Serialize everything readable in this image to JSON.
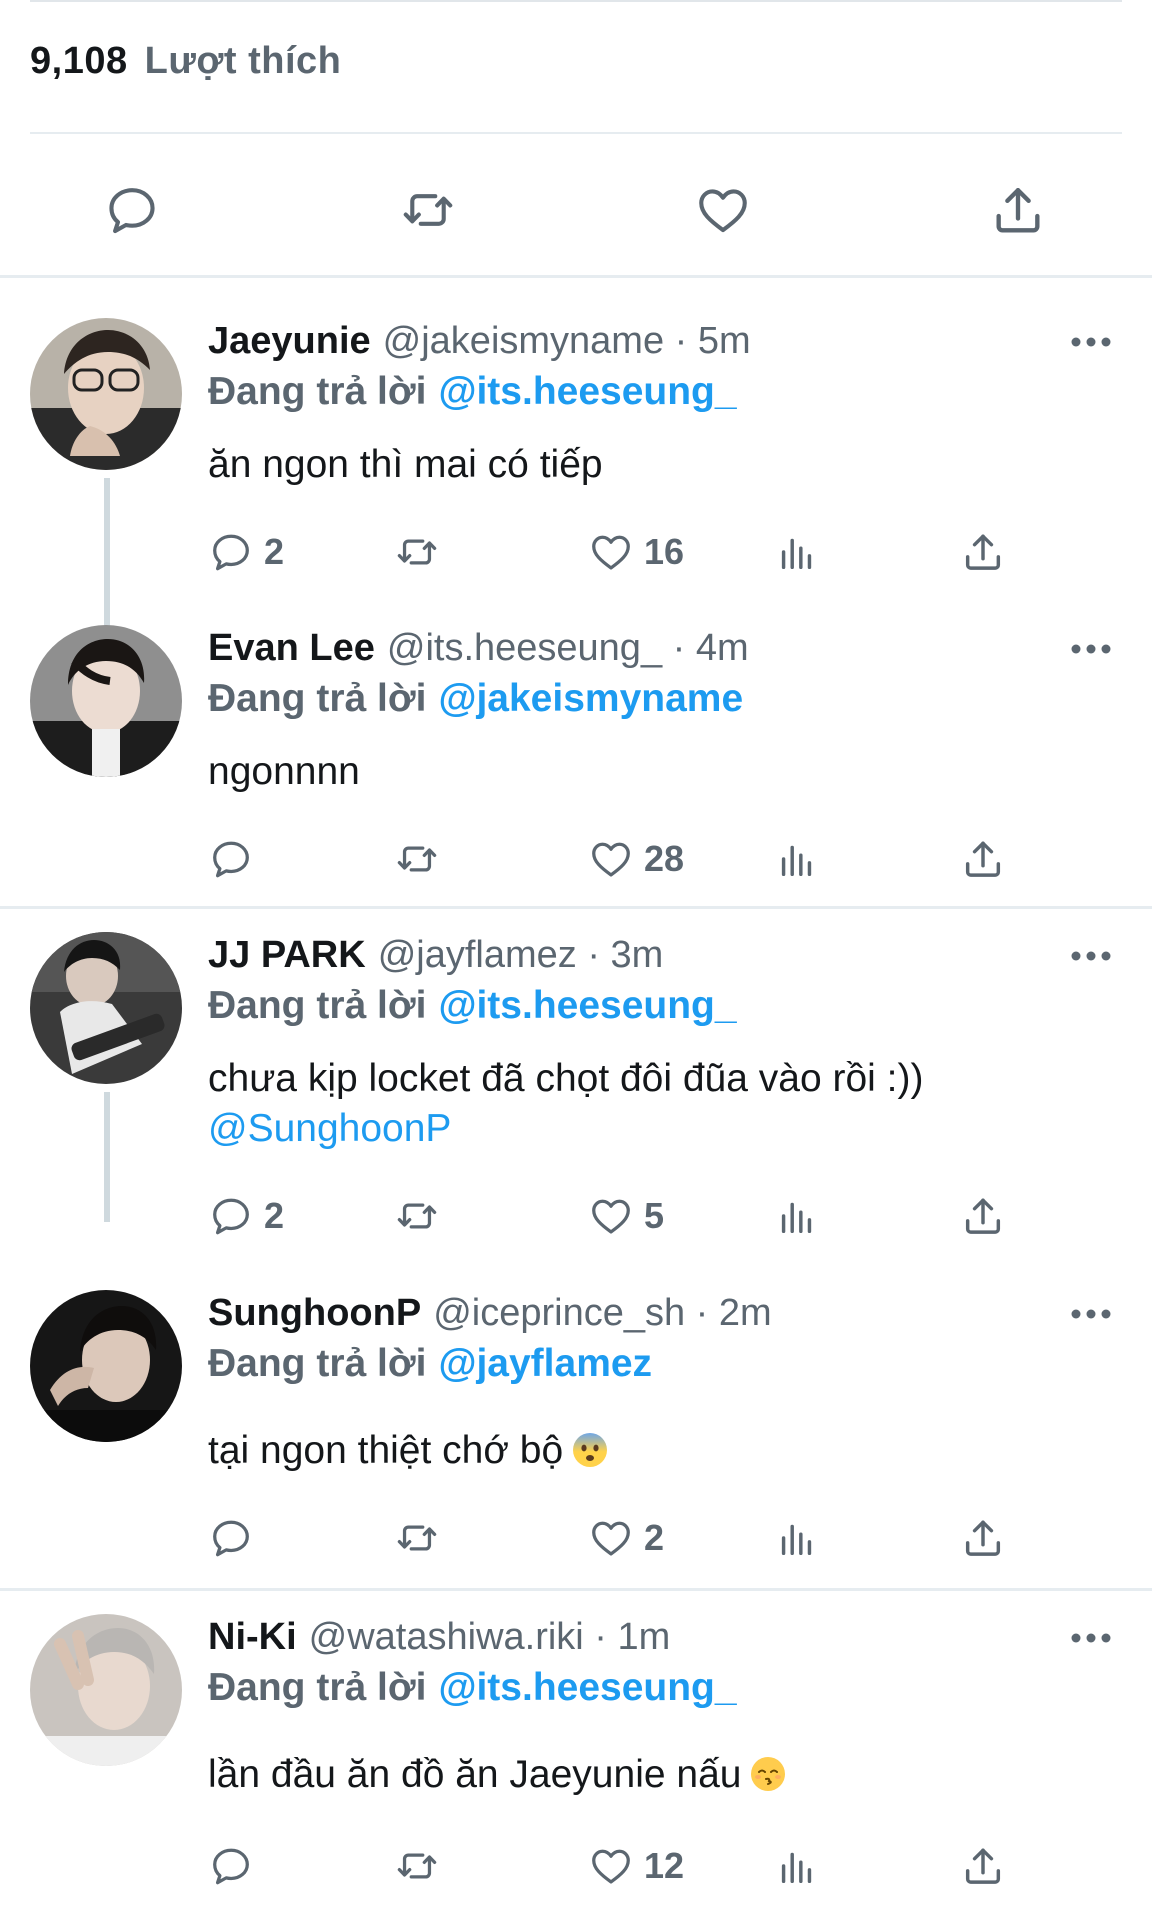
{
  "likes": {
    "count": "9,108",
    "label": "Lượt thích"
  },
  "actionbar": {
    "icons": [
      "reply-icon",
      "retweet-icon",
      "like-icon",
      "share-icon"
    ]
  },
  "tweets": [
    {
      "name": "Jaeyunie",
      "handle": "@jakeismyname · 5m",
      "replying_prefix": "Đang trả lời",
      "replying_to": "@its.heeseung_",
      "text": "ăn ngon thì mai có tiếp",
      "replies": "2",
      "likes": "16"
    },
    {
      "name": "Evan Lee",
      "handle": "@its.heeseung_ · 4m",
      "replying_prefix": "Đang trả lời",
      "replying_to": "@jakeismyname",
      "text": "ngonnnn",
      "replies": "",
      "likes": "28"
    },
    {
      "name": "JJ PARK",
      "handle": "@jayflamez · 3m",
      "replying_prefix": "Đang trả lời",
      "replying_to": "@its.heeseung_",
      "text": "chưa kịp locket đã chọt đôi đũa vào rồi :))",
      "mention": "@SunghoonP",
      "replies": "2",
      "likes": "5"
    },
    {
      "name": "SunghoonP",
      "handle": "@iceprince_sh · 2m",
      "replying_prefix": "Đang trả lời",
      "replying_to": "@jayflamez",
      "text": "tại ngon thiệt chớ bộ",
      "emoji": "fearful-face-emoji",
      "replies": "",
      "likes": "2"
    },
    {
      "name": "Ni-Ki",
      "handle": "@watashiwa.riki · 1m",
      "replying_prefix": "Đang trả lời",
      "replying_to": "@its.heeseung_",
      "text": "lần đầu ăn đồ ăn Jaeyunie nấu",
      "emoji": "kissing-face-emoji",
      "replies": "",
      "likes": "12"
    }
  ],
  "colors": {
    "accent": "#1d9bf0",
    "muted": "#5b6670",
    "text": "#14171a",
    "divider": "#e6ecf0"
  }
}
